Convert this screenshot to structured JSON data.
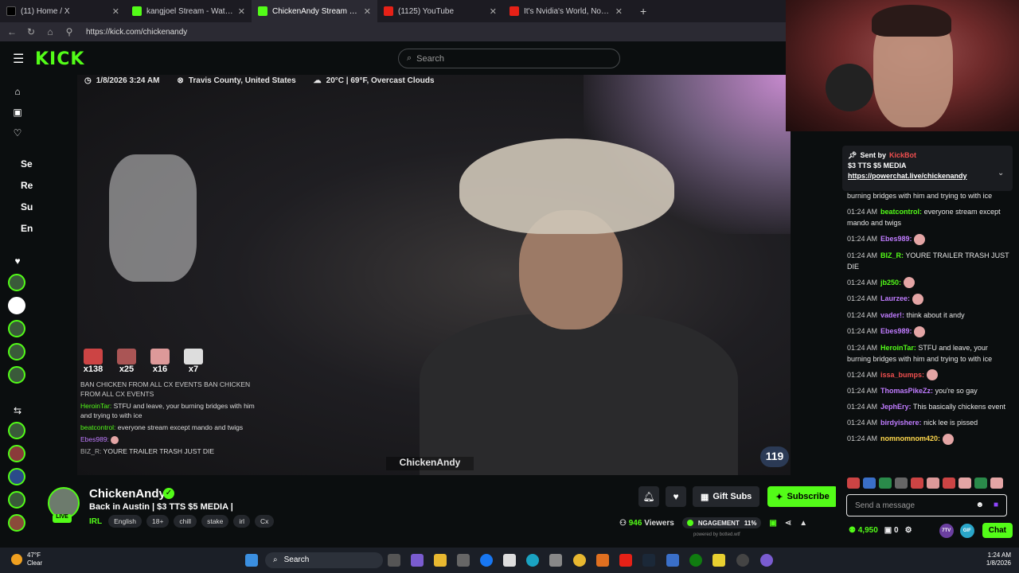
{
  "browser": {
    "tabs": [
      {
        "title": "(11) Home / X",
        "active": false
      },
      {
        "title": "kangjoel Stream - Watch Live",
        "active": false
      },
      {
        "title": "ChickenAndy Stream - Watch",
        "active": true
      },
      {
        "title": "(1125) YouTube",
        "active": false
      },
      {
        "title": "It's Nvidia's World, Now - YouTube",
        "active": false
      }
    ],
    "new_tab": "+",
    "url": "https://kick.com/chickenandy"
  },
  "header": {
    "logo": "KICK",
    "search_placeholder": "Search"
  },
  "leftnav": {
    "partial_labels": [
      "Se",
      "Re",
      "Su",
      "En"
    ]
  },
  "video": {
    "datetime": "1/8/2026 3:24 AM",
    "location": "Travis County, United States",
    "weather": "20°C | 69°F, Overcast Clouds",
    "counters": [
      "x138",
      "x25",
      "x16",
      "x7"
    ],
    "overlay_chat": [
      {
        "user": "",
        "text": "BAN CHICKEN FROM ALL CX EVENTS BAN CHICKEN FROM ALL CX EVENTS"
      },
      {
        "user": "HeroinTar:",
        "text": "STFU and leave, your burning bridges with him and trying to with ice"
      },
      {
        "user": "beatcontrol:",
        "text": "everyone stream except mando and twigs"
      },
      {
        "user": "Ebes989:",
        "text": ""
      },
      {
        "user": "BIZ_R:",
        "text": "YOURE TRAILER TRASH JUST DIE"
      }
    ],
    "watermark": "ChickenAndy",
    "viewer_badge": "119"
  },
  "stream": {
    "name": "ChickenAndy",
    "live": "LIVE",
    "title": "Back in Austin | $3 TTS $5 MEDIA |",
    "category": "IRL",
    "tags": [
      "English",
      "18+",
      "chill",
      "stake",
      "irl",
      "Cx"
    ],
    "gift_label": "Gift Subs",
    "subscribe_label": "Subscribe",
    "viewers": "946",
    "viewers_label": "Viewers",
    "engagement_label": "NGAGEMENT",
    "engagement_pct": "11%",
    "powered_by": "powered by botted.wtf"
  },
  "chat": {
    "pinned": {
      "sent_by": "Sent by",
      "sender": "KickBot",
      "title": "$3 TTS $5 MEDIA",
      "link": "https://powerchat.live/chickenandy"
    },
    "messages": [
      {
        "time": "",
        "user": "",
        "color": "#ffffff",
        "text": "burning bridges with him and trying to with ice"
      },
      {
        "time": "01:24 AM",
        "user": "beatcontrol:",
        "color": "#53fc18",
        "text": "everyone stream except mando and twigs"
      },
      {
        "time": "01:24 AM",
        "user": "Ebes989:",
        "color": "#c07cff",
        "text": ""
      },
      {
        "time": "01:24 AM",
        "user": "BIZ_R:",
        "color": "#53fc18",
        "text": "YOURE TRAILER TRASH JUST DIE"
      },
      {
        "time": "01:24 AM",
        "user": "jb250:",
        "color": "#53fc18",
        "text": ""
      },
      {
        "time": "01:24 AM",
        "user": "Laurzee:",
        "color": "#c07cff",
        "text": ""
      },
      {
        "time": "01:24 AM",
        "user": "vader!:",
        "color": "#c07cff",
        "text": "think about it andy"
      },
      {
        "time": "01:24 AM",
        "user": "Ebes989:",
        "color": "#c07cff",
        "text": ""
      },
      {
        "time": "01:24 AM",
        "user": "HeroinTar:",
        "color": "#53fc18",
        "text": "STFU and leave, your burning bridges with him and trying to with ice"
      },
      {
        "time": "01:24 AM",
        "user": "issa_bumps:",
        "color": "#f04f4f",
        "text": ""
      },
      {
        "time": "01:24 AM",
        "user": "ThomasPikeZz:",
        "color": "#c07cff",
        "text": "you're so gay"
      },
      {
        "time": "01:24 AM",
        "user": "JephEry:",
        "color": "#c07cff",
        "text": "This basically chickens event"
      },
      {
        "time": "01:24 AM",
        "user": "birdyishere:",
        "color": "#c07cff",
        "text": "nick lee is pissed"
      },
      {
        "time": "01:24 AM",
        "user": "nomnomnom420:",
        "color": "#ffd84d",
        "text": ""
      }
    ],
    "input_placeholder": "Send a message",
    "points": "4,950",
    "badges_count": "0",
    "chat_button": "Chat",
    "seventv": "7TV",
    "gif": "GIF"
  },
  "taskbar": {
    "temp": "47°F",
    "condition": "Clear",
    "search": "Search",
    "time": "1:24 AM",
    "date": "1/8/2026"
  },
  "colors": {
    "accent": "#53fc18",
    "bg": "#0b0e0f",
    "panel": "#24272c"
  }
}
